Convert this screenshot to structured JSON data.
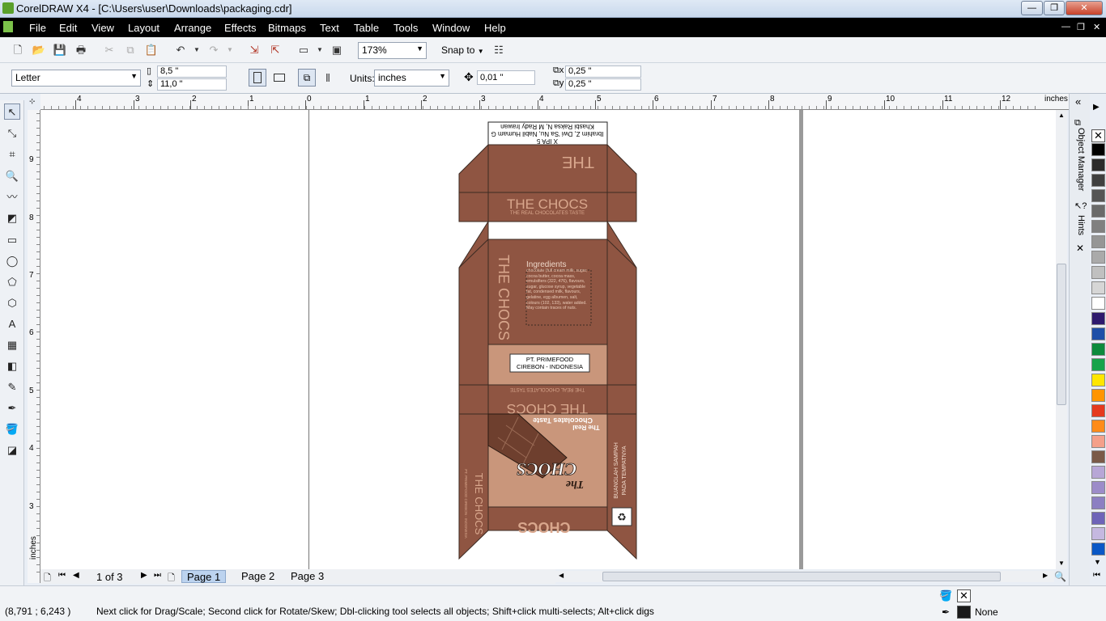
{
  "window": {
    "title": "CorelDRAW X4 - [C:\\Users\\user\\Downloads\\packaging.cdr]",
    "minimize": "—",
    "maximize": "❐",
    "close": "✕"
  },
  "menu": [
    "File",
    "Edit",
    "View",
    "Layout",
    "Arrange",
    "Effects",
    "Bitmaps",
    "Text",
    "Table",
    "Tools",
    "Window",
    "Help"
  ],
  "toolbar": {
    "zoom": "173%",
    "snap": "Snap to"
  },
  "property_bar": {
    "page_size": "Letter",
    "width": "8,5 \"",
    "height": "11,0 \"",
    "units_label": "Units:",
    "units": "inches",
    "nudge": "0,01 \"",
    "dup_x": "0,25 \"",
    "dup_y": "0,25 \""
  },
  "ruler": {
    "h_labels": [
      "4",
      "3",
      "2",
      "1",
      "0",
      "1",
      "2",
      "3",
      "4",
      "5",
      "6",
      "7",
      "8",
      "9",
      "10",
      "11",
      "12"
    ],
    "unit": "inches",
    "v_labels": [
      "9",
      "8",
      "7",
      "6",
      "5",
      "4",
      "3"
    ],
    "v_unit": "inches"
  },
  "design": {
    "credit_line1": "X IPA 5",
    "credit_line2": "Ibrahim Z, Dwi 'Sa Nu, Nabil Humam G",
    "credit_line3": "Khasbi Raksa N, M Rady Irawan",
    "top_flap": "THE",
    "brand": "THE CHOCS",
    "tagline": "THE REAL CHOCOLATES TASTE",
    "side_brand": "THE CHOCS",
    "ingredients_title": "Ingredients",
    "ingredients_text": "chocolate (full cream milk, sugar, cocoa butter, cocoa mass, emulsifiers (322, 476), flavours, sugar, glucose syrup, vegetable fat, condensed milk, flavours, gelatine, egg albumen, salt, colours (102, 133), water added. May contain traces of nuts.",
    "company_line1": "PT. PRIMEFOOD",
    "company_line2": "CIREBON - INDONESIA",
    "front_title1": "The Real",
    "front_title2": "Chocolates Taste",
    "front_logo1": "The",
    "front_logo2": "CHOCS",
    "front_bottom": "CHOCS",
    "left_brand": "THE CHOCS",
    "left_company": "PT. PRIMEFOOD CIREBON - INDONESIA",
    "right_msg1": "BUANGLAH SAMPAH",
    "right_msg2": "PADA TEMPATNYA"
  },
  "pages": {
    "counter": "1 of 3",
    "tabs": [
      "Page 1",
      "Page 2",
      "Page 3"
    ]
  },
  "dockers": {
    "object_manager": "Object Manager",
    "hints": "Hints"
  },
  "palette": [
    "#000000",
    "#2b2b2b",
    "#404040",
    "#555555",
    "#6a6a6a",
    "#808080",
    "#969696",
    "#aaaaaa",
    "#c0c0c0",
    "#d6d6d6",
    "#ffffff",
    "#2e1a6e",
    "#1e4fa8",
    "#0c8a3c",
    "#16a34a",
    "#ffe600",
    "#ff9500",
    "#e53a1e",
    "#ff8c1a",
    "#f4a08a",
    "#7a5a48",
    "#b7a6d6",
    "#9c8cc9",
    "#8c7fc2",
    "#6e64b8",
    "#c5b8e0",
    "#0a58c6"
  ],
  "status": {
    "coords": "(8,791 ; 6,243 )",
    "hint": "Next click for Drag/Scale; Second click for Rotate/Skew; Dbl-clicking tool selects all objects; Shift+click multi-selects; Alt+click digs",
    "fill_none": "None"
  }
}
